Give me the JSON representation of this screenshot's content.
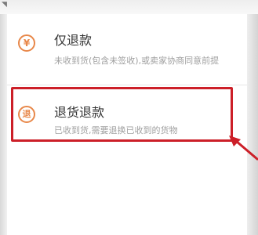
{
  "refund_only": {
    "title": "仅退款",
    "description": "未收到货(包含未签收),或卖家协商同意前提",
    "icon": "yen-return-icon"
  },
  "return_refund": {
    "title": "退货退款",
    "description": "已收到货,需要退换已收到的货物",
    "icon": "return-char-icon",
    "icon_glyph": "退"
  },
  "colors": {
    "accent": "#e8884a",
    "highlight": "#cc1f28",
    "title": "#333333",
    "description": "#a0a0a0"
  }
}
